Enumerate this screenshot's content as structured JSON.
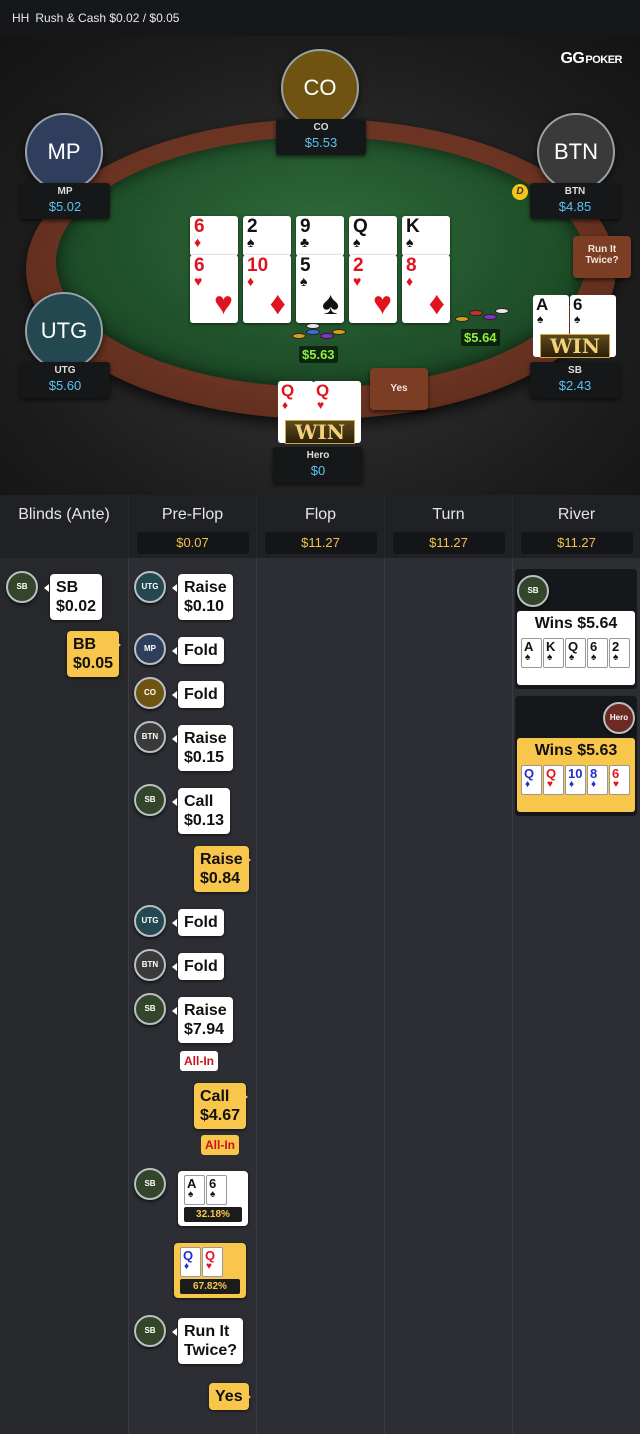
{
  "header": {
    "game": "HH",
    "title": "Rush & Cash $0.02 / $0.05"
  },
  "logo": {
    "main": "GG",
    "sub": "POKER"
  },
  "seats": {
    "co": {
      "circle": "CO",
      "name": "CO",
      "stack": "$5.53",
      "color": "#6e5410"
    },
    "mp": {
      "circle": "MP",
      "name": "MP",
      "stack": "$5.02",
      "color": "#2e3e5c"
    },
    "btn": {
      "circle": "BTN",
      "name": "BTN",
      "stack": "$4.85",
      "color": "#3a3a3a"
    },
    "utg": {
      "circle": "UTG",
      "name": "UTG",
      "stack": "$5.60",
      "color": "#234850"
    },
    "sb": {
      "name": "SB",
      "stack": "$2.43"
    },
    "hero": {
      "name": "Hero",
      "stack": "$0"
    }
  },
  "dealer_button": "D",
  "board": {
    "run1": [
      {
        "r": "6",
        "s": "♦",
        "c": "red"
      },
      {
        "r": "2",
        "s": "♠",
        "c": "blk"
      },
      {
        "r": "9",
        "s": "♣",
        "c": "blk"
      },
      {
        "r": "Q",
        "s": "♠",
        "c": "blk"
      },
      {
        "r": "K",
        "s": "♠",
        "c": "blk"
      }
    ],
    "run2": [
      {
        "r": "6",
        "s": "♥",
        "c": "red"
      },
      {
        "r": "10",
        "s": "♦",
        "c": "red"
      },
      {
        "r": "5",
        "s": "♠",
        "c": "blk"
      },
      {
        "r": "2",
        "s": "♥",
        "c": "red"
      },
      {
        "r": "8",
        "s": "♦",
        "c": "red"
      }
    ]
  },
  "sb_hand": [
    {
      "r": "A",
      "s": "♠",
      "c": "blk"
    },
    {
      "r": "6",
      "s": "♠",
      "c": "blk"
    }
  ],
  "hero_hand": [
    {
      "r": "Q",
      "s": "♦",
      "c": "red"
    },
    {
      "r": "Q",
      "s": "♥",
      "c": "red"
    }
  ],
  "win_label": "WIN",
  "pots": {
    "left": "$5.63",
    "right": "$5.64"
  },
  "table_prompts": {
    "run_it_twice": "Run It Twice?",
    "yes": "Yes"
  },
  "history": {
    "columns": [
      {
        "title": "Blinds (Ante)",
        "pot": ""
      },
      {
        "title": "Pre-Flop",
        "pot": "$0.07"
      },
      {
        "title": "Flop",
        "pot": "$11.27"
      },
      {
        "title": "Turn",
        "pot": "$11.27"
      },
      {
        "title": "River",
        "pot": "$11.27"
      }
    ],
    "blinds": {
      "sb_avatar": "SB",
      "sb_line1": "SB",
      "sb_line2": "$0.02",
      "bb_line1": "BB",
      "bb_line2": "$0.05"
    },
    "preflop": [
      {
        "avatar": "UTG",
        "line1": "Raise",
        "line2": "$0.10"
      },
      {
        "avatar": "MP",
        "line1": "Fold",
        "line2": ""
      },
      {
        "avatar": "CO",
        "line1": "Fold",
        "line2": ""
      },
      {
        "avatar": "BTN",
        "line1": "Raise",
        "line2": "$0.15"
      },
      {
        "avatar": "SB",
        "line1": "Call",
        "line2": "$0.13"
      },
      {
        "hero": true,
        "line1": "Raise",
        "line2": "$0.84"
      },
      {
        "avatar": "UTG",
        "line1": "Fold",
        "line2": ""
      },
      {
        "avatar": "BTN",
        "line1": "Fold",
        "line2": ""
      },
      {
        "avatar": "SB",
        "line1": "Raise",
        "line2": "$7.94"
      },
      {
        "hero": true,
        "line1": "Call",
        "line2": "$4.67"
      }
    ],
    "all_in": "All-In",
    "sb_equity": "32.18%",
    "hero_equity": "67.82%",
    "rit_sb_avatar": "SB",
    "rit_question_1": "Run It",
    "rit_question_2": "Twice?",
    "rit_answer": "Yes",
    "river": {
      "sb_avatar": "SB",
      "sb_win": "Wins $5.64",
      "sb_cards": [
        {
          "r": "A",
          "s": "♠",
          "c": "blk"
        },
        {
          "r": "K",
          "s": "♠",
          "c": "blk"
        },
        {
          "r": "Q",
          "s": "♠",
          "c": "blk"
        },
        {
          "r": "6",
          "s": "♠",
          "c": "blk"
        },
        {
          "r": "2",
          "s": "♠",
          "c": "blk"
        }
      ],
      "hero_avatar": "Hero",
      "hero_win": "Wins $5.63",
      "hero_cards": [
        {
          "r": "Q",
          "s": "♦",
          "c": "blue"
        },
        {
          "r": "Q",
          "s": "♥",
          "c": "red"
        },
        {
          "r": "10",
          "s": "♦",
          "c": "blue"
        },
        {
          "r": "8",
          "s": "♦",
          "c": "blue"
        },
        {
          "r": "6",
          "s": "♥",
          "c": "red"
        }
      ]
    }
  }
}
